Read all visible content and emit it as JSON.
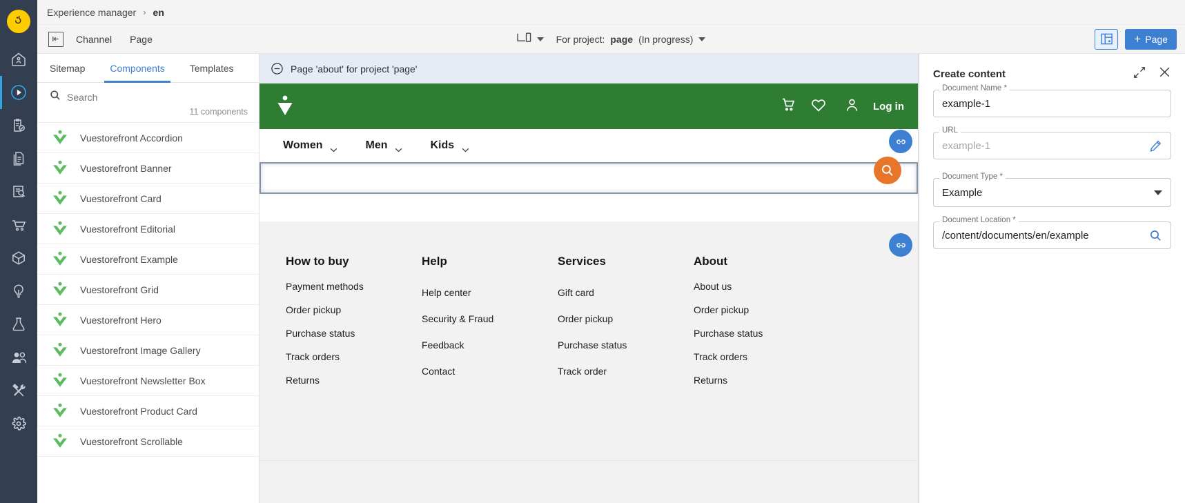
{
  "colors": {
    "rail_bg": "#333e50",
    "accent_blue": "#3d7fd1",
    "brand_green": "#2f7d32",
    "brand_orange": "#e8762a",
    "logo_yellow": "#ffcc00",
    "component_green": "#5cbb61"
  },
  "rail": {
    "logo_name": "bloomreach-logo-icon",
    "items": [
      {
        "name": "home-icon",
        "label": "Home",
        "active": false
      },
      {
        "name": "experience-manager-icon",
        "label": "Experience manager",
        "active": true
      },
      {
        "name": "projects-clipboard-icon",
        "label": "Projects",
        "active": false
      },
      {
        "name": "documents-icon",
        "label": "Documents",
        "active": false
      },
      {
        "name": "content-search-icon",
        "label": "Content search",
        "active": false
      },
      {
        "name": "cart-icon",
        "label": "Commerce",
        "active": false
      },
      {
        "name": "package-icon",
        "label": "Products",
        "active": false
      },
      {
        "name": "lightbulb-icon",
        "label": "Insights",
        "active": false
      },
      {
        "name": "flask-icon",
        "label": "Experiments",
        "active": false
      },
      {
        "name": "audiences-icon",
        "label": "Audiences",
        "active": false
      },
      {
        "name": "tools-icon",
        "label": "Tools",
        "active": false
      },
      {
        "name": "gear-icon",
        "label": "Settings",
        "active": false
      }
    ]
  },
  "breadcrumb": {
    "root": "Experience manager",
    "separator": "›",
    "current": "en"
  },
  "toolbar": {
    "collapse_icon": "collapse-panel-icon",
    "channel_label": "Channel",
    "page_label": "Page",
    "device_icon": "device-preview-icon",
    "project_prefix": "For project:",
    "project_name": "page",
    "project_status": "(In progress)",
    "toggle_components_icon": "page-structure-icon",
    "add_page_label": "Page",
    "add_page_plus": "+"
  },
  "left_panel": {
    "tabs": [
      {
        "label": "Sitemap",
        "active": false
      },
      {
        "label": "Components",
        "active": true
      },
      {
        "label": "Templates",
        "active": false
      }
    ],
    "search_placeholder": "Search",
    "search_value": "",
    "count_label": "11 components",
    "components": [
      "Vuestorefront Accordion",
      "Vuestorefront Banner",
      "Vuestorefront Card",
      "Vuestorefront Editorial",
      "Vuestorefront Example",
      "Vuestorefront Grid",
      "Vuestorefront Hero",
      "Vuestorefront Image Gallery",
      "Vuestorefront Newsletter Box",
      "Vuestorefront Product Card",
      "Vuestorefront Scrollable"
    ]
  },
  "preview": {
    "notice": "Page 'about' for project 'page'",
    "notice_icon": "minus-circle-icon",
    "store": {
      "logo_icon": "vuestorefront-logo-icon",
      "cart_icon": "shopping-cart-icon",
      "wishlist_icon": "heart-icon",
      "account_icon": "person-icon",
      "login_label": "Log in",
      "nav": [
        {
          "label": "Women",
          "caret": "chevron-down-icon"
        },
        {
          "label": "Men",
          "caret": "chevron-down-icon"
        },
        {
          "label": "Kids",
          "caret": "chevron-down-icon"
        }
      ],
      "search_fab_icon": "search-icon",
      "footer": [
        {
          "heading": "How to buy",
          "links": [
            "Payment methods",
            "Order pickup",
            "Purchase status",
            "Track orders",
            "Returns"
          ]
        },
        {
          "heading": "Help",
          "links": [
            "Help center",
            "Security & Fraud",
            "Feedback",
            "Contact"
          ]
        },
        {
          "heading": "Services",
          "links": [
            "Gift card",
            "Order pickup",
            "Purchase status",
            "Track order"
          ]
        },
        {
          "heading": "About",
          "links": [
            "About us",
            "Order pickup",
            "Purchase status",
            "Track orders",
            "Returns"
          ]
        }
      ]
    },
    "link_badges": [
      {
        "name": "link-badge-header",
        "icon": "link-icon"
      },
      {
        "name": "link-badge-footer",
        "icon": "link-icon"
      }
    ]
  },
  "right_panel": {
    "title": "Create content",
    "expand_icon": "expand-diagonal-icon",
    "close_icon": "close-icon",
    "fields": [
      {
        "label": "Document Name *",
        "value": "example-1",
        "placeholder": "",
        "icon": ""
      },
      {
        "label": "URL",
        "value": "",
        "placeholder": "example-1",
        "icon": "pencil-edit-icon"
      },
      {
        "label": "Document Type *",
        "value": "Example",
        "placeholder": "",
        "icon": "chevron-down-icon"
      },
      {
        "label": "Document Location *",
        "value": "/content/documents/en/example",
        "placeholder": "",
        "icon": "search-icon"
      }
    ]
  }
}
